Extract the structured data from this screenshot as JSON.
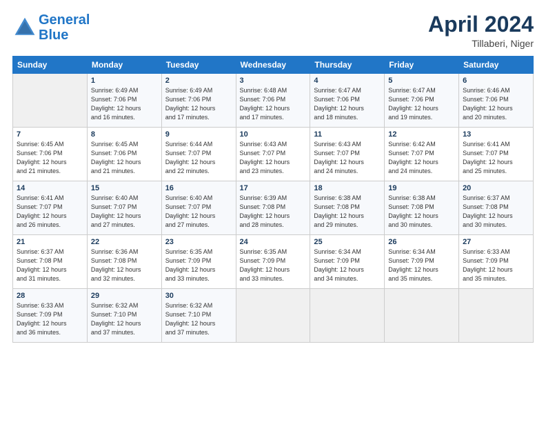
{
  "header": {
    "logo_line1": "General",
    "logo_line2": "Blue",
    "title": "April 2024",
    "location": "Tillaberi, Niger"
  },
  "days_of_week": [
    "Sunday",
    "Monday",
    "Tuesday",
    "Wednesday",
    "Thursday",
    "Friday",
    "Saturday"
  ],
  "weeks": [
    [
      {
        "day": "",
        "sunrise": "",
        "sunset": "",
        "daylight": ""
      },
      {
        "day": "1",
        "sunrise": "Sunrise: 6:49 AM",
        "sunset": "Sunset: 7:06 PM",
        "daylight": "Daylight: 12 hours and 16 minutes."
      },
      {
        "day": "2",
        "sunrise": "Sunrise: 6:49 AM",
        "sunset": "Sunset: 7:06 PM",
        "daylight": "Daylight: 12 hours and 17 minutes."
      },
      {
        "day": "3",
        "sunrise": "Sunrise: 6:48 AM",
        "sunset": "Sunset: 7:06 PM",
        "daylight": "Daylight: 12 hours and 17 minutes."
      },
      {
        "day": "4",
        "sunrise": "Sunrise: 6:47 AM",
        "sunset": "Sunset: 7:06 PM",
        "daylight": "Daylight: 12 hours and 18 minutes."
      },
      {
        "day": "5",
        "sunrise": "Sunrise: 6:47 AM",
        "sunset": "Sunset: 7:06 PM",
        "daylight": "Daylight: 12 hours and 19 minutes."
      },
      {
        "day": "6",
        "sunrise": "Sunrise: 6:46 AM",
        "sunset": "Sunset: 7:06 PM",
        "daylight": "Daylight: 12 hours and 20 minutes."
      }
    ],
    [
      {
        "day": "7",
        "sunrise": "Sunrise: 6:45 AM",
        "sunset": "Sunset: 7:06 PM",
        "daylight": "Daylight: 12 hours and 21 minutes."
      },
      {
        "day": "8",
        "sunrise": "Sunrise: 6:45 AM",
        "sunset": "Sunset: 7:06 PM",
        "daylight": "Daylight: 12 hours and 21 minutes."
      },
      {
        "day": "9",
        "sunrise": "Sunrise: 6:44 AM",
        "sunset": "Sunset: 7:07 PM",
        "daylight": "Daylight: 12 hours and 22 minutes."
      },
      {
        "day": "10",
        "sunrise": "Sunrise: 6:43 AM",
        "sunset": "Sunset: 7:07 PM",
        "daylight": "Daylight: 12 hours and 23 minutes."
      },
      {
        "day": "11",
        "sunrise": "Sunrise: 6:43 AM",
        "sunset": "Sunset: 7:07 PM",
        "daylight": "Daylight: 12 hours and 24 minutes."
      },
      {
        "day": "12",
        "sunrise": "Sunrise: 6:42 AM",
        "sunset": "Sunset: 7:07 PM",
        "daylight": "Daylight: 12 hours and 24 minutes."
      },
      {
        "day": "13",
        "sunrise": "Sunrise: 6:41 AM",
        "sunset": "Sunset: 7:07 PM",
        "daylight": "Daylight: 12 hours and 25 minutes."
      }
    ],
    [
      {
        "day": "14",
        "sunrise": "Sunrise: 6:41 AM",
        "sunset": "Sunset: 7:07 PM",
        "daylight": "Daylight: 12 hours and 26 minutes."
      },
      {
        "day": "15",
        "sunrise": "Sunrise: 6:40 AM",
        "sunset": "Sunset: 7:07 PM",
        "daylight": "Daylight: 12 hours and 27 minutes."
      },
      {
        "day": "16",
        "sunrise": "Sunrise: 6:40 AM",
        "sunset": "Sunset: 7:07 PM",
        "daylight": "Daylight: 12 hours and 27 minutes."
      },
      {
        "day": "17",
        "sunrise": "Sunrise: 6:39 AM",
        "sunset": "Sunset: 7:08 PM",
        "daylight": "Daylight: 12 hours and 28 minutes."
      },
      {
        "day": "18",
        "sunrise": "Sunrise: 6:38 AM",
        "sunset": "Sunset: 7:08 PM",
        "daylight": "Daylight: 12 hours and 29 minutes."
      },
      {
        "day": "19",
        "sunrise": "Sunrise: 6:38 AM",
        "sunset": "Sunset: 7:08 PM",
        "daylight": "Daylight: 12 hours and 30 minutes."
      },
      {
        "day": "20",
        "sunrise": "Sunrise: 6:37 AM",
        "sunset": "Sunset: 7:08 PM",
        "daylight": "Daylight: 12 hours and 30 minutes."
      }
    ],
    [
      {
        "day": "21",
        "sunrise": "Sunrise: 6:37 AM",
        "sunset": "Sunset: 7:08 PM",
        "daylight": "Daylight: 12 hours and 31 minutes."
      },
      {
        "day": "22",
        "sunrise": "Sunrise: 6:36 AM",
        "sunset": "Sunset: 7:08 PM",
        "daylight": "Daylight: 12 hours and 32 minutes."
      },
      {
        "day": "23",
        "sunrise": "Sunrise: 6:35 AM",
        "sunset": "Sunset: 7:09 PM",
        "daylight": "Daylight: 12 hours and 33 minutes."
      },
      {
        "day": "24",
        "sunrise": "Sunrise: 6:35 AM",
        "sunset": "Sunset: 7:09 PM",
        "daylight": "Daylight: 12 hours and 33 minutes."
      },
      {
        "day": "25",
        "sunrise": "Sunrise: 6:34 AM",
        "sunset": "Sunset: 7:09 PM",
        "daylight": "Daylight: 12 hours and 34 minutes."
      },
      {
        "day": "26",
        "sunrise": "Sunrise: 6:34 AM",
        "sunset": "Sunset: 7:09 PM",
        "daylight": "Daylight: 12 hours and 35 minutes."
      },
      {
        "day": "27",
        "sunrise": "Sunrise: 6:33 AM",
        "sunset": "Sunset: 7:09 PM",
        "daylight": "Daylight: 12 hours and 35 minutes."
      }
    ],
    [
      {
        "day": "28",
        "sunrise": "Sunrise: 6:33 AM",
        "sunset": "Sunset: 7:09 PM",
        "daylight": "Daylight: 12 hours and 36 minutes."
      },
      {
        "day": "29",
        "sunrise": "Sunrise: 6:32 AM",
        "sunset": "Sunset: 7:10 PM",
        "daylight": "Daylight: 12 hours and 37 minutes."
      },
      {
        "day": "30",
        "sunrise": "Sunrise: 6:32 AM",
        "sunset": "Sunset: 7:10 PM",
        "daylight": "Daylight: 12 hours and 37 minutes."
      },
      {
        "day": "",
        "sunrise": "",
        "sunset": "",
        "daylight": ""
      },
      {
        "day": "",
        "sunrise": "",
        "sunset": "",
        "daylight": ""
      },
      {
        "day": "",
        "sunrise": "",
        "sunset": "",
        "daylight": ""
      },
      {
        "day": "",
        "sunrise": "",
        "sunset": "",
        "daylight": ""
      }
    ]
  ]
}
